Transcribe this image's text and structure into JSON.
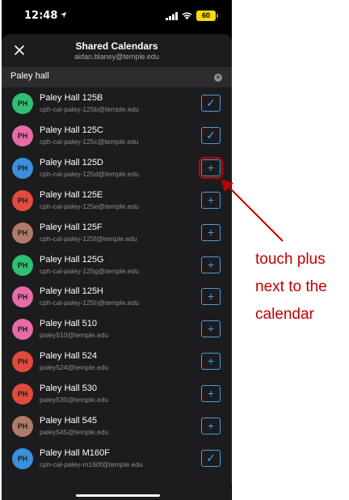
{
  "status_bar": {
    "time": "12:48",
    "battery": "60"
  },
  "header": {
    "title": "Shared Calendars",
    "subtitle": "aidan.blaney@temple.edu"
  },
  "search": {
    "value": "Paley hall"
  },
  "calendars": [
    {
      "initials": "PH",
      "name": "Paley Hall 125B",
      "email": "cph-cal-paley-125b@temple.edu",
      "avatar_color": "#2fbf71",
      "added": true,
      "action": "✓"
    },
    {
      "initials": "PH",
      "name": "Paley Hall 125C",
      "email": "cph-cal-paley-125c@temple.edu",
      "avatar_color": "#e86aa6",
      "added": true,
      "action": "✓"
    },
    {
      "initials": "PH",
      "name": "Paley Hall 125D",
      "email": "cph-cal-paley-125d@temple.edu",
      "avatar_color": "#3b8fdc",
      "added": false,
      "action": "+"
    },
    {
      "initials": "PH",
      "name": "Paley Hall 125E",
      "email": "cph-cal-paley-125e@temple.edu",
      "avatar_color": "#e24a3b",
      "added": false,
      "action": "+"
    },
    {
      "initials": "PH",
      "name": "Paley Hall 125F",
      "email": "cph-cal-paley-125f@temple.edu",
      "avatar_color": "#b07a68",
      "added": false,
      "action": "+"
    },
    {
      "initials": "PH",
      "name": "Paley Hall 125G",
      "email": "cph-cal-paley-125g@temple.edu",
      "avatar_color": "#2fbf71",
      "added": false,
      "action": "+"
    },
    {
      "initials": "PH",
      "name": "Paley Hall 125H",
      "email": "cph-cal-paley-125h@temple.edu",
      "avatar_color": "#e86aa6",
      "added": false,
      "action": "+"
    },
    {
      "initials": "PH",
      "name": "Paley Hall 510",
      "email": "paley510@temple.edu",
      "avatar_color": "#e86aa6",
      "added": false,
      "action": "+"
    },
    {
      "initials": "PH",
      "name": "Paley Hall 524",
      "email": "paley524@temple.edu",
      "avatar_color": "#e24a3b",
      "added": false,
      "action": "+"
    },
    {
      "initials": "PH",
      "name": "Paley Hall 530",
      "email": "paley530@temple.edu",
      "avatar_color": "#e24a3b",
      "added": false,
      "action": "+"
    },
    {
      "initials": "PH",
      "name": "Paley Hall 545",
      "email": "paley545@temple.edu",
      "avatar_color": "#b07a68",
      "added": false,
      "action": "+"
    },
    {
      "initials": "PH",
      "name": "Paley Hall M160F",
      "email": "cph-cal-paley-m160f@temple.edu",
      "avatar_color": "#3b8fdc",
      "added": true,
      "action": "✓"
    }
  ],
  "annotation": {
    "lines": [
      "touch plus",
      "next to the",
      "calendar"
    ],
    "color": "#c00000"
  },
  "colors": {
    "accent": "#4a9eda",
    "sheet_bg": "#1c1c1e",
    "annotation": "#c00000"
  }
}
